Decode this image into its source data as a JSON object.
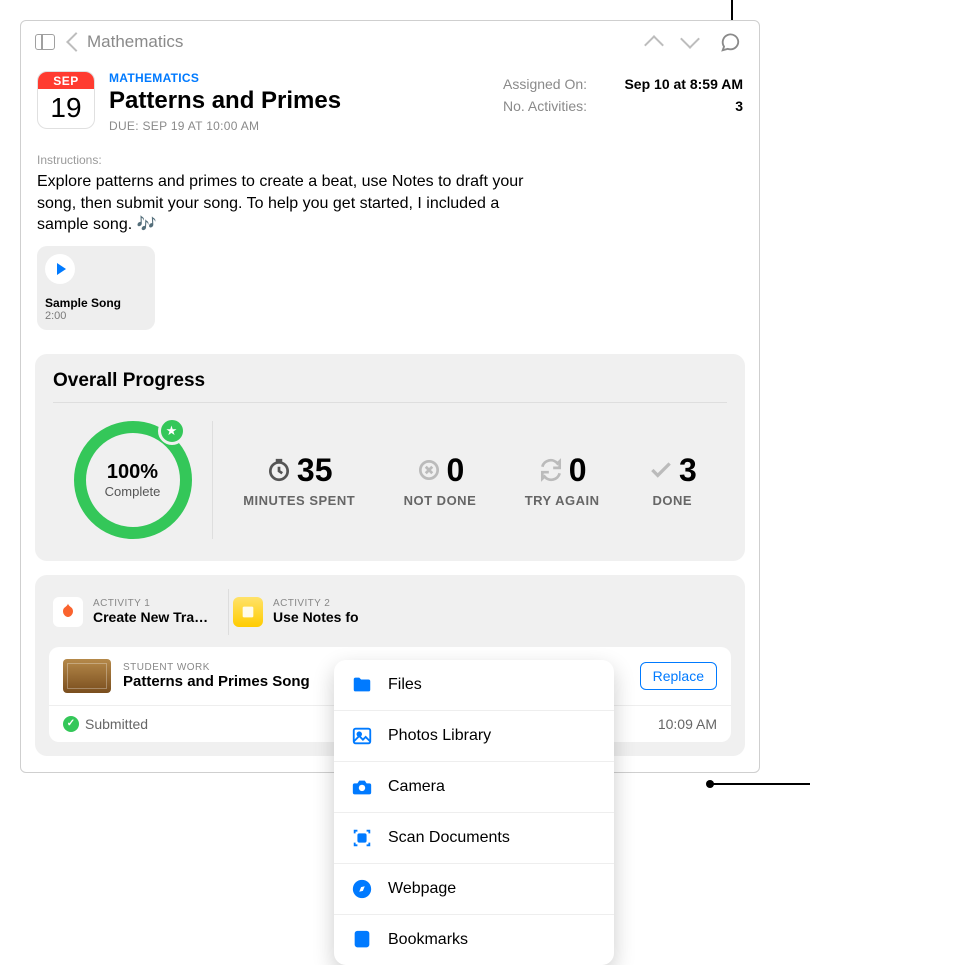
{
  "nav": {
    "back_label": "Mathematics"
  },
  "header": {
    "cal_month": "SEP",
    "cal_day": "19",
    "category": "MATHEMATICS",
    "title": "Patterns and Primes",
    "due": "DUE: SEP 19 AT 10:00 AM"
  },
  "meta": {
    "assigned_label": "Assigned On:",
    "assigned_value": "Sep 10 at 8:59 AM",
    "activities_label": "No. Activities:",
    "activities_value": "3"
  },
  "instructions": {
    "label": "Instructions:",
    "text": "Explore patterns and primes to create a beat, use Notes to draft your song, then submit your song. To help you get started, I included a sample song. 🎶"
  },
  "attachment": {
    "title": "Sample Song",
    "duration": "2:00"
  },
  "progress": {
    "heading": "Overall Progress",
    "pct_text": "100%",
    "pct_sub": "Complete",
    "stats": {
      "minutes_value": "35",
      "minutes_label": "MINUTES SPENT",
      "notdone_value": "0",
      "notdone_label": "NOT DONE",
      "tryagain_value": "0",
      "tryagain_label": "TRY AGAIN",
      "done_value": "3",
      "done_label": "DONE"
    }
  },
  "activities": {
    "a1_label": "ACTIVITY 1",
    "a1_name": "Create New Tra…",
    "a2_label": "ACTIVITY 2",
    "a2_name": "Use Notes fo"
  },
  "student_work": {
    "label": "STUDENT WORK",
    "name": "Patterns and Primes Song",
    "replace_label": "Replace",
    "status_label": "Submitted",
    "status_time": "10:09 AM"
  },
  "popover": {
    "item0": "Files",
    "item1": "Photos Library",
    "item2": "Camera",
    "item3": "Scan Documents",
    "item4": "Webpage",
    "item5": "Bookmarks"
  }
}
